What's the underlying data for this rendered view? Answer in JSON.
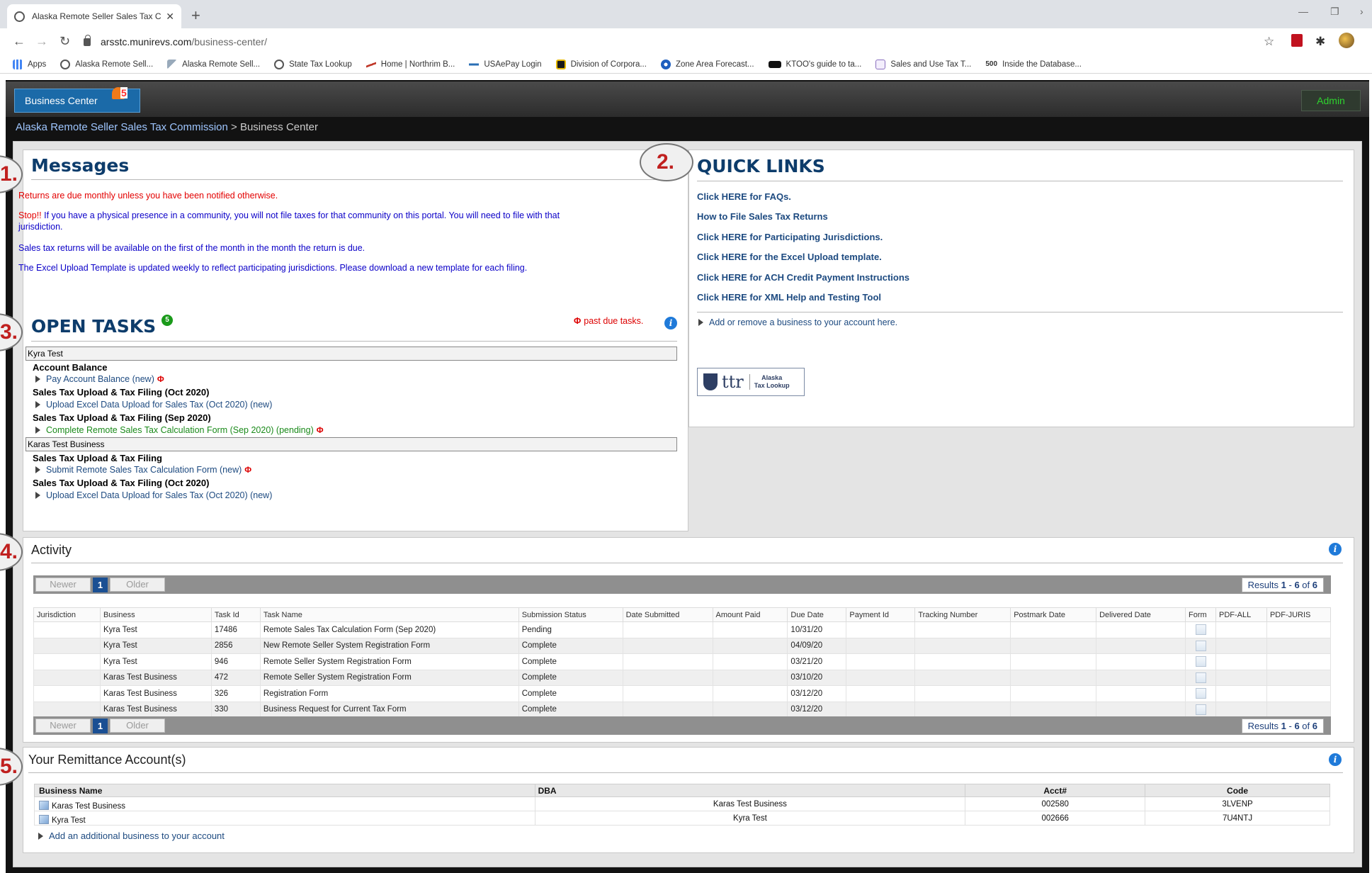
{
  "browser": {
    "tab_title": "Alaska Remote Seller Sales Tax C",
    "url_host": "arsstc.munirevs.com",
    "url_path": "/business-center/",
    "bookmarks": [
      "Apps",
      "Alaska Remote Sell...",
      "Alaska Remote Sell...",
      "State Tax Lookup",
      "Home | Northrim B...",
      "USAePay Login",
      "Division of Corpora...",
      "Zone Area Forecast...",
      "KTOO's guide to ta...",
      "Sales and Use Tax T...",
      "Inside the Database..."
    ],
    "bookmark_prefix_500": "500"
  },
  "header": {
    "business_center": "Business Center",
    "notification_count": "5",
    "admin": "Admin",
    "breadcrumb_link": "Alaska Remote Seller Sales Tax Commission",
    "breadcrumb_current": "> Business Center"
  },
  "steps": [
    "1.",
    "2.",
    "3.",
    "4.",
    "5."
  ],
  "messages": {
    "title": "Messages",
    "line1": "Returns are due monthly unless you have been notified otherwise.",
    "line2_stop": "Stop!!",
    "line2_rest": "If you have a  physical presence in a community, you will not file taxes for that community on this portal. You will need to file with that",
    "line2_cont": "jurisdiction.",
    "line3": "Sales tax returns will be available on the first of the month in the month the return is due.",
    "line4": "The Excel Upload Template is updated weekly to reflect participating jurisdictions. Please download a new template for each filing."
  },
  "quick_links": {
    "title": "QUICK LINKS",
    "links": [
      "Click HERE for FAQs.",
      "How to File Sales Tax Returns",
      "Click HERE for Participating Jurisdictions.",
      "Click HERE for the Excel Upload template.",
      "Click HERE for ACH Credit Payment Instructions",
      "Click HERE for XML Help and Testing Tool"
    ],
    "add_remove": "Add or remove a business to your account here.",
    "ttr_logo": "ttr",
    "ttr_caption_1": "Alaska",
    "ttr_caption_2": "Tax Lookup"
  },
  "open_tasks": {
    "title": "OPEN TASKS",
    "badge": "5",
    "past_due": "past due tasks.",
    "phi": "Φ",
    "group1": "Kyra Test",
    "g1_h1": "Account Balance",
    "g1_l1": "Pay Account Balance (new)",
    "g1_h2": "Sales Tax Upload & Tax Filing (Oct 2020)",
    "g1_l2": "Upload Excel Data Upload for Sales Tax (Oct 2020) (new)",
    "g1_h3": "Sales Tax Upload & Tax Filing (Sep 2020)",
    "g1_l3": "Complete Remote Sales Tax Calculation Form (Sep 2020) (pending)",
    "group2": "Karas Test Business",
    "g2_h1": "Sales Tax Upload & Tax Filing",
    "g2_l1": "Submit Remote Sales Tax Calculation Form (new)",
    "g2_h2": "Sales Tax Upload & Tax Filing (Oct 2020)",
    "g2_l2": "Upload Excel Data Upload for Sales Tax (Oct 2020) (new)"
  },
  "activity": {
    "title": "Activity",
    "pager": {
      "newer": "Newer",
      "page": "1",
      "older": "Older",
      "results_prefix": "Results",
      "from": "1",
      "dash": "-",
      "to": "6",
      "of": "of",
      "total": "6"
    },
    "columns": [
      "Jurisdiction",
      "Business",
      "Task Id",
      "Task Name",
      "Submission Status",
      "Date Submitted",
      "Amount Paid",
      "Due Date",
      "Payment Id",
      "Tracking Number",
      "Postmark Date",
      "Delivered Date",
      "Form",
      "PDF-ALL",
      "PDF-JURIS"
    ],
    "rows": [
      {
        "jurisdiction": "",
        "business": "Kyra Test",
        "task_id": "17486",
        "task_name": "Remote Sales Tax Calculation Form (Sep 2020)",
        "status": "Pending",
        "due": "10/31/20"
      },
      {
        "jurisdiction": "",
        "business": "Kyra Test",
        "task_id": "2856",
        "task_name": "New Remote Seller System Registration Form",
        "status": "Complete",
        "due": "04/09/20"
      },
      {
        "jurisdiction": "",
        "business": "Kyra Test",
        "task_id": "946",
        "task_name": "Remote Seller System Registration Form",
        "status": "Complete",
        "due": "03/21/20"
      },
      {
        "jurisdiction": "",
        "business": "Karas Test Business",
        "task_id": "472",
        "task_name": "Remote Seller System Registration Form",
        "status": "Complete",
        "due": "03/10/20"
      },
      {
        "jurisdiction": "",
        "business": "Karas Test Business",
        "task_id": "326",
        "task_name": "Registration Form",
        "status": "Complete",
        "due": "03/12/20"
      },
      {
        "jurisdiction": "",
        "business": "Karas Test Business",
        "task_id": "330",
        "task_name": "Business Request for Current Tax Form",
        "status": "Complete",
        "due": "03/12/20"
      }
    ]
  },
  "remittance": {
    "title": "Your Remittance Account(s)",
    "columns": [
      "Business Name",
      "DBA",
      "Acct#",
      "Code"
    ],
    "rows": [
      {
        "name": "Karas Test Business",
        "dba": "Karas Test Business",
        "acct": "002580",
        "code": "3LVENP"
      },
      {
        "name": "Kyra Test",
        "dba": "Kyra Test",
        "acct": "002666",
        "code": "7U4NTJ"
      }
    ],
    "add_business": "Add an additional business to your account"
  }
}
